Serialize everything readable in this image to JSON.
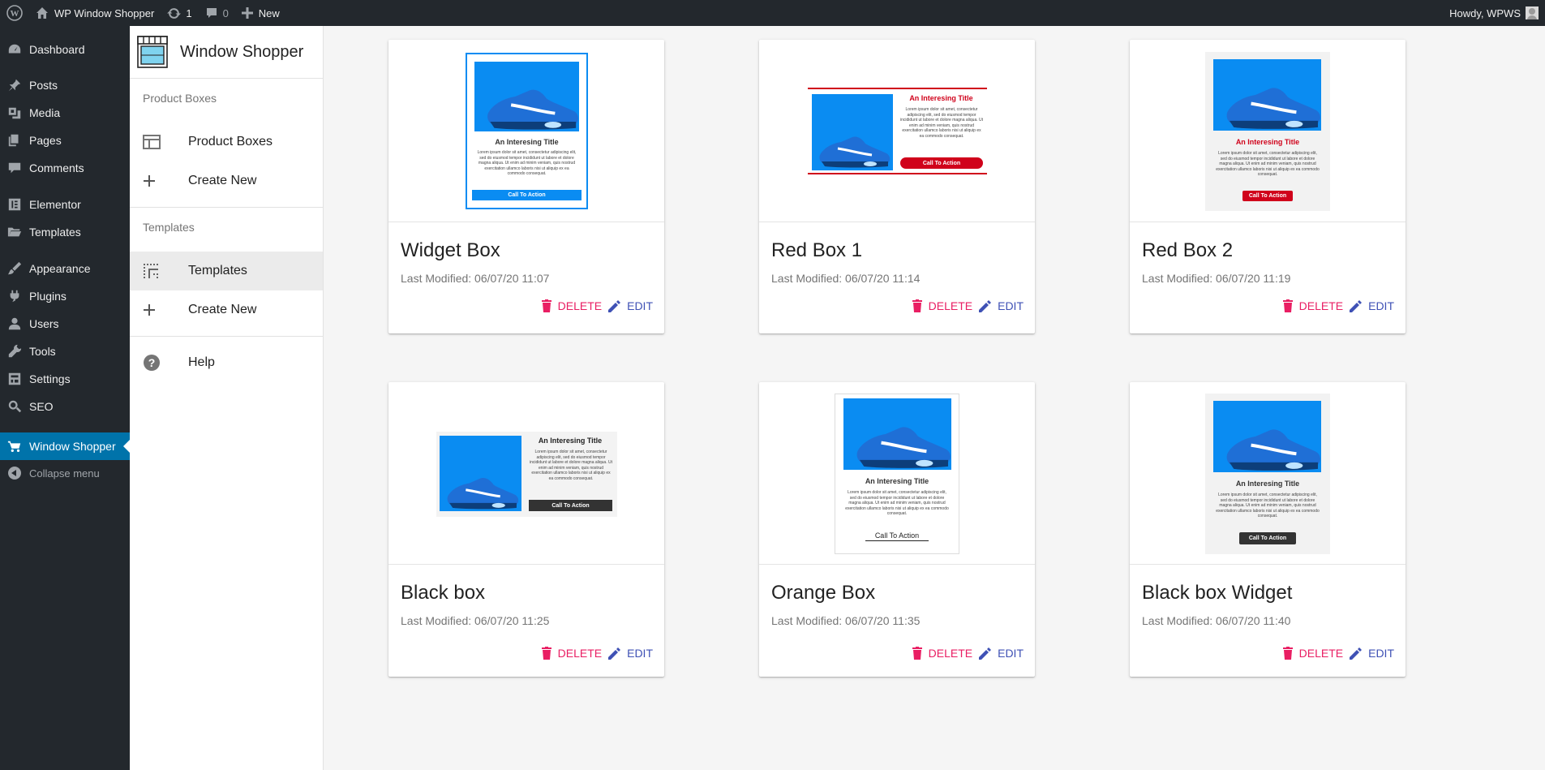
{
  "admin_bar": {
    "site_name": "WP Window Shopper",
    "updates_count": "1",
    "comments_count": "0",
    "new_label": "New",
    "howdy": "Howdy, WPWS"
  },
  "wp_menu": {
    "items": [
      {
        "label": "Dashboard",
        "icon": "dashboard-icon"
      },
      {
        "label": "Posts",
        "icon": "pin-icon"
      },
      {
        "label": "Media",
        "icon": "media-icon"
      },
      {
        "label": "Pages",
        "icon": "pages-icon"
      },
      {
        "label": "Comments",
        "icon": "comments-icon"
      },
      {
        "label": "Elementor",
        "icon": "elementor-icon"
      },
      {
        "label": "Templates",
        "icon": "folder-icon"
      },
      {
        "label": "Appearance",
        "icon": "brush-icon"
      },
      {
        "label": "Plugins",
        "icon": "plug-icon"
      },
      {
        "label": "Users",
        "icon": "user-icon"
      },
      {
        "label": "Tools",
        "icon": "wrench-icon"
      },
      {
        "label": "Settings",
        "icon": "settings-icon"
      },
      {
        "label": "SEO",
        "icon": "search-icon"
      },
      {
        "label": "Window Shopper",
        "icon": "cart-icon",
        "active": true
      }
    ],
    "collapse_label": "Collapse menu",
    "active_color": "#0073aa"
  },
  "sidebar": {
    "title": "Window Shopper",
    "sections": [
      {
        "header": "Product Boxes",
        "items": [
          {
            "label": "Product Boxes",
            "icon": "product-box-icon"
          },
          {
            "label": "Create New",
            "icon": "plus-icon"
          }
        ]
      },
      {
        "header": "Templates",
        "items": [
          {
            "label": "Templates",
            "icon": "templates-grid-icon",
            "selected": true
          },
          {
            "label": "Create New",
            "icon": "plus-icon"
          }
        ]
      }
    ],
    "help_label": "Help"
  },
  "preview": {
    "title": "An Interesing Title",
    "body": "Lorem ipsum dolor sit amet, consectetur adipiscing elit, sed do eiusmod tempor incididunt ut labore et dolore magna aliqua. Ut enim ad minim veniam, quis nostrud exercitation ullamco laboris nisi ut aliquip ex ea commodo consequat.",
    "cta": "Call To Action"
  },
  "cards": [
    {
      "title": "Widget Box",
      "modified": "Last Modified: 06/07/20 11:07",
      "accent": "#0a8cf2"
    },
    {
      "title": "Red Box 1",
      "modified": "Last Modified: 06/07/20 11:14",
      "accent": "#d0021b"
    },
    {
      "title": "Red Box 2",
      "modified": "Last Modified: 06/07/20 11:19",
      "accent": "#d0021b"
    },
    {
      "title": "Black box",
      "modified": "Last Modified: 06/07/20 11:25",
      "accent": "#333333"
    },
    {
      "title": "Orange Box",
      "modified": "Last Modified: 06/07/20 11:35",
      "accent": "#333333"
    },
    {
      "title": "Black box Widget",
      "modified": "Last Modified: 06/07/20 11:40",
      "accent": "#333333"
    }
  ],
  "actions": {
    "delete": "DELETE",
    "edit": "EDIT"
  },
  "colors": {
    "delete": "#e91e63",
    "edit": "#3f51b5",
    "admin_bg": "#23282d"
  }
}
